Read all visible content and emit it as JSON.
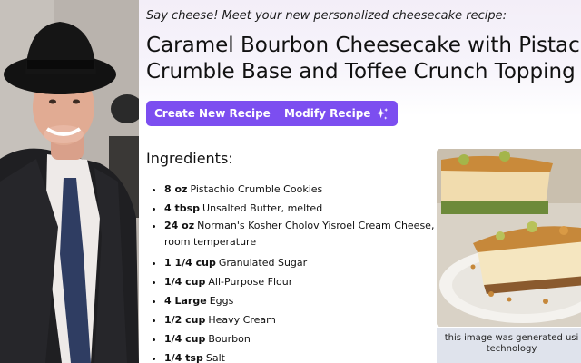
{
  "header": {
    "tagline": "Say cheese! Meet your new personalized cheesecake recipe:",
    "title_line1": "Caramel Bourbon Cheesecake with Pistachio",
    "title_line2": "Crumble Base and Toffee Crunch Topping"
  },
  "actions": {
    "create_label": "Create New Recipe",
    "modify_label": "Modify Recipe",
    "icon": "sparkles-icon"
  },
  "ingredients": {
    "heading": "Ingredients:",
    "items": [
      {
        "qty": "8 oz",
        "name": "Pistachio Crumble Cookies"
      },
      {
        "qty": "4 tbsp",
        "name": "Unsalted Butter, melted"
      },
      {
        "qty": "24 oz",
        "name": "Norman's Kosher Cholov Yisroel Cream Cheese, at room temperature"
      },
      {
        "qty": "1 1/4 cup",
        "name": "Granulated Sugar"
      },
      {
        "qty": "1/4 cup",
        "name": "All-Purpose Flour"
      },
      {
        "qty": "4 Large",
        "name": "Eggs"
      },
      {
        "qty": "1/2 cup",
        "name": "Heavy Cream"
      },
      {
        "qty": "1/4 cup",
        "name": "Bourbon"
      },
      {
        "qty": "1/4 tsp",
        "name": "Salt"
      }
    ]
  },
  "image_caption": {
    "line1": "this image was generated usi",
    "line2": "technology"
  },
  "colors": {
    "accent": "#7c4ef0",
    "caption_bg": "#dfe3ec"
  }
}
